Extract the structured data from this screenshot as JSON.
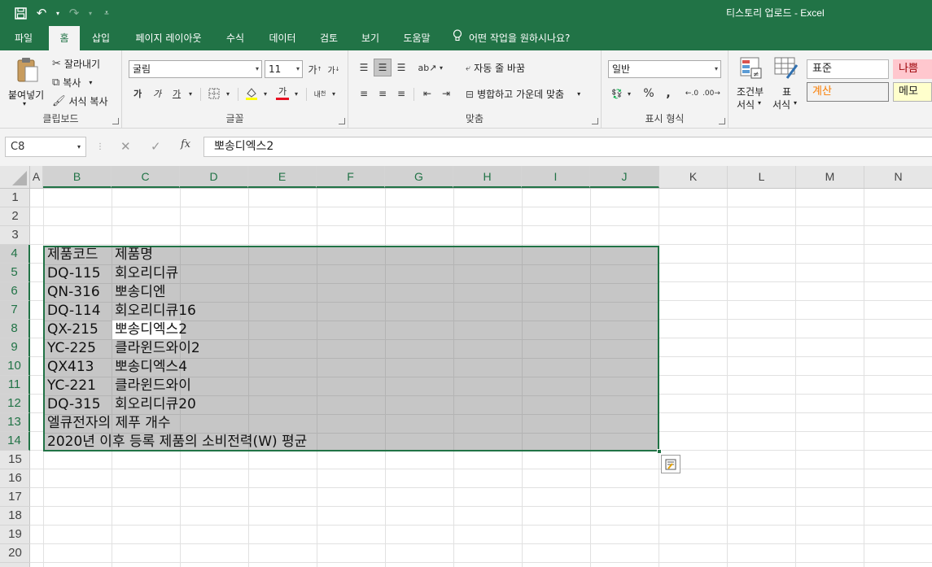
{
  "window": {
    "title": "티스토리 업로드  -  Excel"
  },
  "qat": {
    "save_icon": "save-icon",
    "undo_icon": "undo-icon",
    "redo_icon": "redo-icon"
  },
  "menu": {
    "tabs": [
      "파일",
      "홈",
      "삽입",
      "페이지 레이아웃",
      "수식",
      "데이터",
      "검토",
      "보기",
      "도움말"
    ],
    "active": "홈",
    "tell_me": "어떤 작업을 원하시나요?"
  },
  "ribbon": {
    "clipboard": {
      "paste": "붙여넣기",
      "cut": "잘라내기",
      "copy": "복사",
      "format_painter": "서식 복사",
      "label": "클립보드"
    },
    "font": {
      "name": "굴림",
      "size": "11",
      "bold": "가",
      "italic": "가",
      "underline": "가",
      "font_color_glyph": "가",
      "label": "글꼴"
    },
    "alignment": {
      "wrap_text": "자동 줄 바꿈",
      "merge_center": "병합하고 가운데 맞춤",
      "label": "맞춤"
    },
    "number": {
      "format": "일반",
      "percent": "%",
      "comma": ",",
      "label": "표시 형식"
    },
    "styles": {
      "conditional": "조건부",
      "conditional2": "서식",
      "table": "표",
      "table2": "서식",
      "normal": "표준",
      "bad": "나쁨",
      "calc": "계산",
      "memo": "메모"
    }
  },
  "formula_bar": {
    "name_box": "C8",
    "cancel": "✕",
    "enter": "✓",
    "fx": "fx",
    "content": "뽀송디엑스2"
  },
  "columns": [
    "A",
    "B",
    "C",
    "D",
    "E",
    "F",
    "G",
    "H",
    "I",
    "J",
    "K",
    "L",
    "M",
    "N"
  ],
  "rows": [
    "1",
    "2",
    "3",
    "4",
    "5",
    "6",
    "7",
    "8",
    "9",
    "10",
    "11",
    "12",
    "13",
    "14",
    "15",
    "16",
    "17",
    "18",
    "19",
    "20"
  ],
  "cells": {
    "B4": "제품코드",
    "C4": "제품명",
    "B5": "DQ-115",
    "C5": "회오리디큐",
    "B6": "QN-316",
    "C6": "뽀송디엔",
    "B7": "DQ-114",
    "C7": "회오리디큐16",
    "B8": "QX-215",
    "C8": "뽀송디엑스2",
    "B9": "YC-225",
    "C9": "클라윈드와이2",
    "B10": "QX413",
    "C10": "뽀송디엑스4",
    "B11": "YC-221",
    "C11": "클라윈드와이",
    "B12": "DQ-315",
    "C12": "회오리디큐20",
    "B13": "엘큐전자의 제푸 개수",
    "B14": "2020년 이후 등록 제품의 소비전력(W) 평균"
  },
  "colors": {
    "accent": "#217346",
    "selection": "#c6c6c6"
  }
}
